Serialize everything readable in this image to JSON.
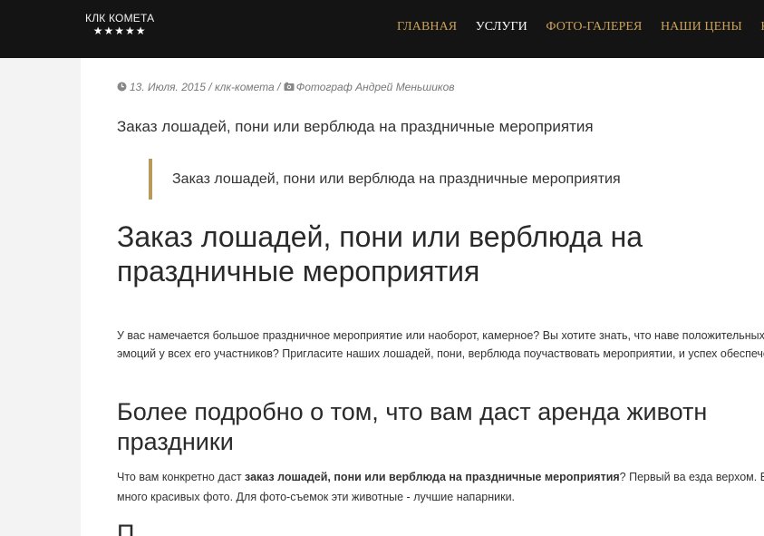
{
  "header": {
    "logo_title": "КЛК КОМЕТА",
    "logo_stars": "★★★★★",
    "nav": [
      {
        "label": "ГЛАВНАЯ",
        "active": false
      },
      {
        "label": "УСЛУГИ",
        "active": true
      },
      {
        "label": "ФОТО-ГАЛЕРЕЯ",
        "active": false
      },
      {
        "label": "НАШИ ЦЕНЫ",
        "active": false
      },
      {
        "label": "КО",
        "active": false
      }
    ]
  },
  "post": {
    "meta": {
      "date": "13. Июля. 2015",
      "sep1": "/",
      "author": "клк-комета",
      "sep2": "/",
      "category": "Фотограф Андрей Меньшиков"
    },
    "subtitle": "Заказ лошадей, пони или верблюда на праздничные мероприятия",
    "quote": "Заказ лошадей, пони или верблюда на праздничные мероприятия",
    "heading": "Заказ лошадей, пони или верблюда на праздничные мероприятия",
    "paragraph1": "У вас намечается большое праздничное мероприятие или наоборот, камерное? Вы хотите знать, что наве положительных эмоций у всех его участников? Пригласите наших лошадей, пони, верблюда поучаствовать мероприятии, и успех обеспечен.",
    "heading2": "Более подробно о том, что вам даст аренда животн праздники",
    "paragraph2_start": "Что вам конкретно даст ",
    "paragraph2_bold": "заказ лошадей, пони или верблюда на праздничные мероприятия",
    "paragraph2_end": "? Первый ва езда верхом. Второй - много красивых фото. Для фото-съемок эти животные - лучшие  напарники.",
    "heading3_partial": "П"
  },
  "colors": {
    "header_bg": "#141414",
    "nav_link": "#c9a15a",
    "nav_active": "#ffffff",
    "quote_border": "#b99a5c"
  }
}
